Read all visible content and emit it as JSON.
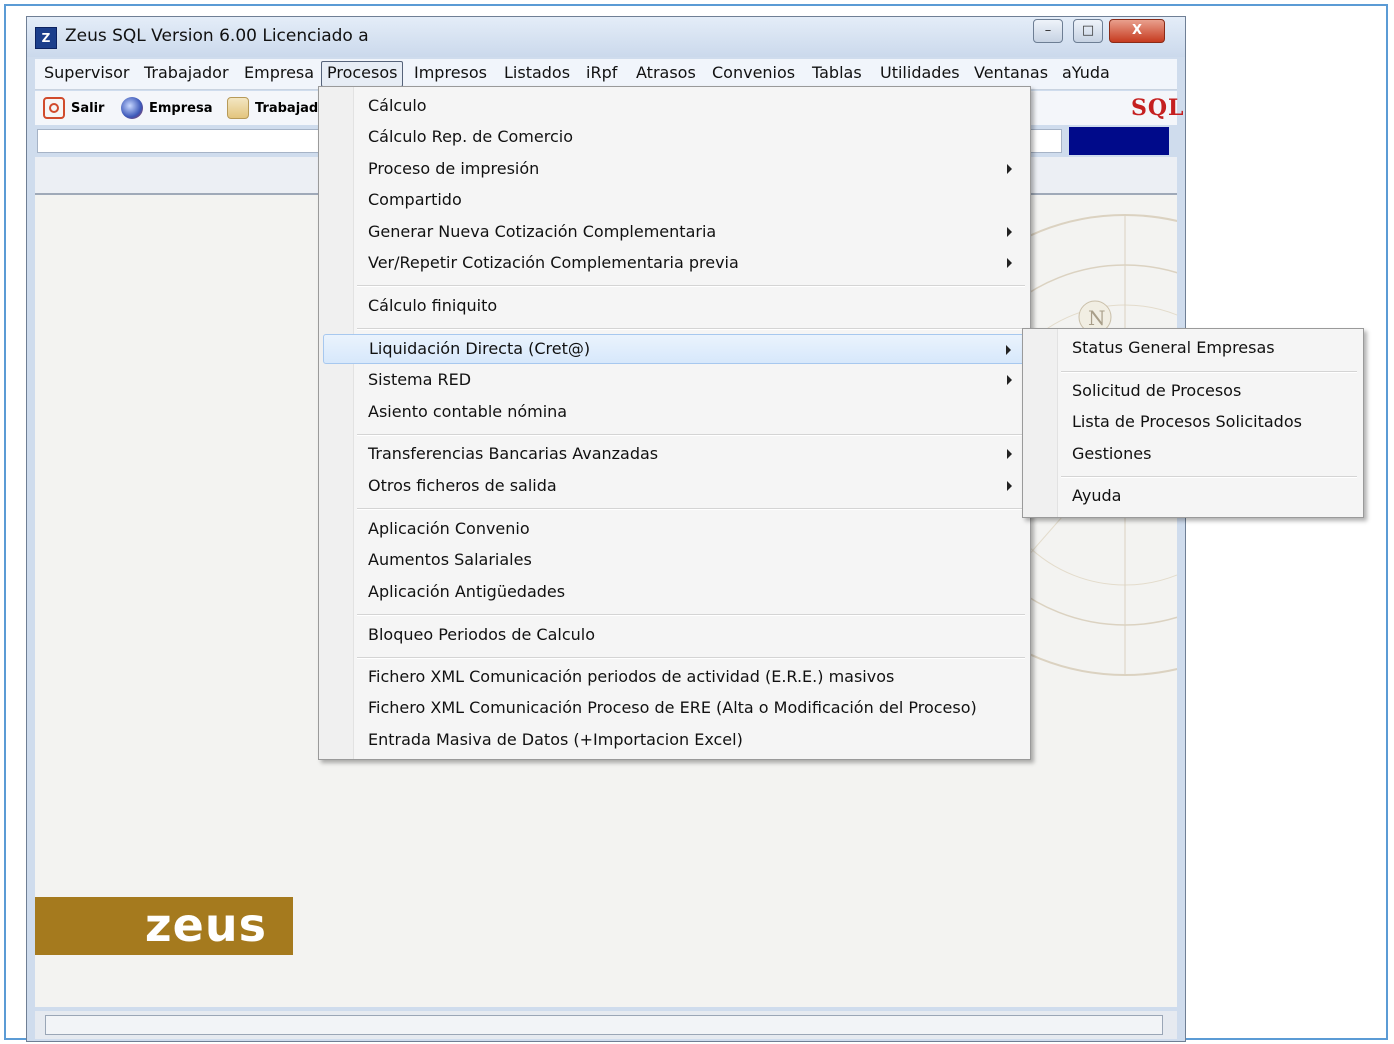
{
  "window": {
    "title": "Zeus SQL Version 6.00 Licenciado a",
    "app_icon_letter": "Z",
    "controls": {
      "minimize": "–",
      "maximize": "□",
      "close": "X"
    }
  },
  "menubar": {
    "items": [
      "Supervisor",
      "Trabajador",
      "Empresa",
      "Procesos",
      "Impresos",
      "Listados",
      "iRpf",
      "Atrasos",
      "Convenios",
      "Tablas",
      "Utilidades",
      "Ventanas",
      "aYuda"
    ],
    "active": "Procesos"
  },
  "toolbar": {
    "salir": "Salir",
    "empresa": "Empresa",
    "trabajador": "Trabajad"
  },
  "brand": {
    "sql_logo": "SQL",
    "banner": "zeus",
    "banner_color": "#a57a1e",
    "accent_blue": "#000a8a"
  },
  "procesos_menu": {
    "items": [
      {
        "label": "Cálculo",
        "submenu": false
      },
      {
        "label": "Cálculo Rep. de Comercio",
        "submenu": false
      },
      {
        "label": "Proceso de impresión",
        "submenu": true
      },
      {
        "label": "Compartido",
        "submenu": false
      },
      {
        "label": "Generar Nueva Cotización Complementaria",
        "submenu": true
      },
      {
        "label": "Ver/Repetir Cotización Complementaria previa",
        "submenu": true
      },
      {
        "label": "Cálculo finiquito",
        "submenu": false
      },
      {
        "label": "Liquidación Directa (Cret@)",
        "submenu": true,
        "highlighted": true
      },
      {
        "label": "Sistema RED",
        "submenu": true
      },
      {
        "label": "Asiento contable nómina",
        "submenu": false
      },
      {
        "label": "Transferencias Bancarias Avanzadas",
        "submenu": true
      },
      {
        "label": "Otros ficheros de salida",
        "submenu": true
      },
      {
        "label": "Aplicación Convenio",
        "submenu": false
      },
      {
        "label": "Aumentos Salariales",
        "submenu": false
      },
      {
        "label": "Aplicación Antigüedades",
        "submenu": false
      },
      {
        "label": "Bloqueo Periodos de Calculo",
        "submenu": false
      },
      {
        "label": "Fichero XML Comunicación periodos de actividad (E.R.E.) masivos",
        "submenu": false
      },
      {
        "label": "Fichero XML Comunicación Proceso de ERE (Alta o Modificación del Proceso)",
        "submenu": false
      },
      {
        "label": "Entrada Masiva de Datos (+Importacion Excel)",
        "submenu": false
      }
    ]
  },
  "liquidacion_submenu": {
    "items": [
      "Status General Empresas",
      "Solicitud de Procesos",
      "Lista de Procesos Solicitados",
      "Gestiones",
      "Ayuda"
    ]
  }
}
